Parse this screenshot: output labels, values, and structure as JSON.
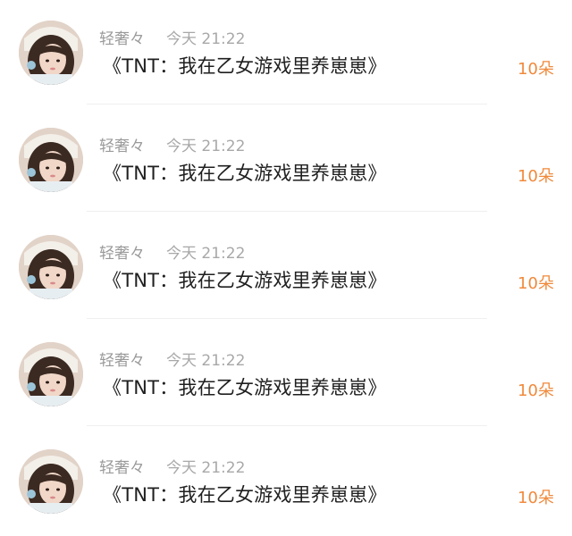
{
  "comments": [
    {
      "username": "轻奢々",
      "time": "今天 21:22",
      "message": "《TNT：我在乙女游戏里养崽崽》",
      "gift": "10朵"
    },
    {
      "username": "轻奢々",
      "time": "今天 21:22",
      "message": "《TNT：我在乙女游戏里养崽崽》",
      "gift": "10朵"
    },
    {
      "username": "轻奢々",
      "time": "今天 21:22",
      "message": "《TNT：我在乙女游戏里养崽崽》",
      "gift": "10朵"
    },
    {
      "username": "轻奢々",
      "time": "今天 21:22",
      "message": "《TNT：我在乙女游戏里养崽崽》",
      "gift": "10朵"
    },
    {
      "username": "轻奢々",
      "time": "今天 21:22",
      "message": "《TNT：我在乙女游戏里养崽崽》",
      "gift": "10朵"
    }
  ],
  "colors": {
    "gift_text": "#f08a3c",
    "username_text": "#9a9a9a",
    "message_text": "#1f1f1f",
    "divider": "#efefef"
  }
}
